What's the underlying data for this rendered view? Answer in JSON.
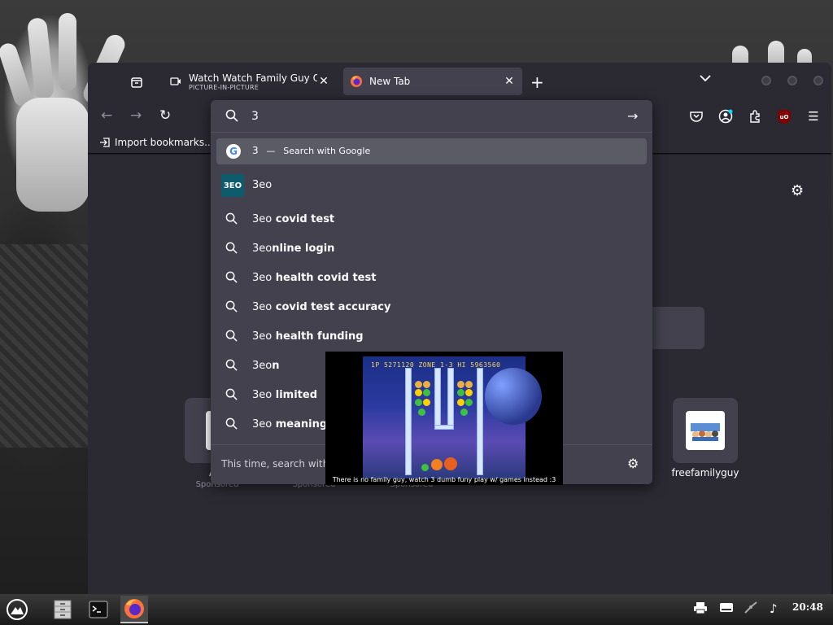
{
  "window": {
    "tabs": [
      {
        "title": "Watch Watch Family Guy Onlin",
        "subtitle": "PICTURE-IN-PICTURE",
        "icon": "pip-video-icon"
      },
      {
        "title": "New Tab",
        "icon": "firefox-icon"
      }
    ],
    "bookmarks": {
      "import_label": "Import bookmarks..."
    }
  },
  "urlbar": {
    "value": "3",
    "highlight": {
      "query": "3",
      "separator": "—",
      "action": "Search with Google"
    },
    "site": {
      "label": "3eo",
      "icon_text": "3EO"
    },
    "suggestions": [
      {
        "prefix": "3eo",
        "rest": " covid test"
      },
      {
        "prefix": "3eo",
        "rest": "nline login"
      },
      {
        "prefix": "3eo",
        "rest": " health covid test"
      },
      {
        "prefix": "3eo",
        "rest": " covid test accuracy"
      },
      {
        "prefix": "3eo",
        "rest": " health funding"
      },
      {
        "prefix": "3eo",
        "rest": "n"
      },
      {
        "prefix": "3eo",
        "rest": " limited"
      },
      {
        "prefix": "3eo",
        "rest": " meaning"
      }
    ],
    "oneoff_label": "This time, search with:"
  },
  "newtab": {
    "tiles": [
      {
        "label": "Am",
        "sponsor": "Sponsored"
      },
      {
        "label": "",
        "sponsor": "Sponsored"
      },
      {
        "label": "",
        "sponsor": "Sponsored"
      },
      {
        "label": "freefamilyguy",
        "sponsor": ""
      }
    ]
  },
  "pip": {
    "hud": "1P   5271120  ZONE 1-3   HI   5963560",
    "subtitle": "There is no family guy, watch 3 dumb funy play w/ games instead :3"
  },
  "taskbar": {
    "clock": "20:48"
  },
  "colors": {
    "accent": "#5b5b66",
    "surface": "#42414d",
    "chrome": "#2b2a33"
  }
}
